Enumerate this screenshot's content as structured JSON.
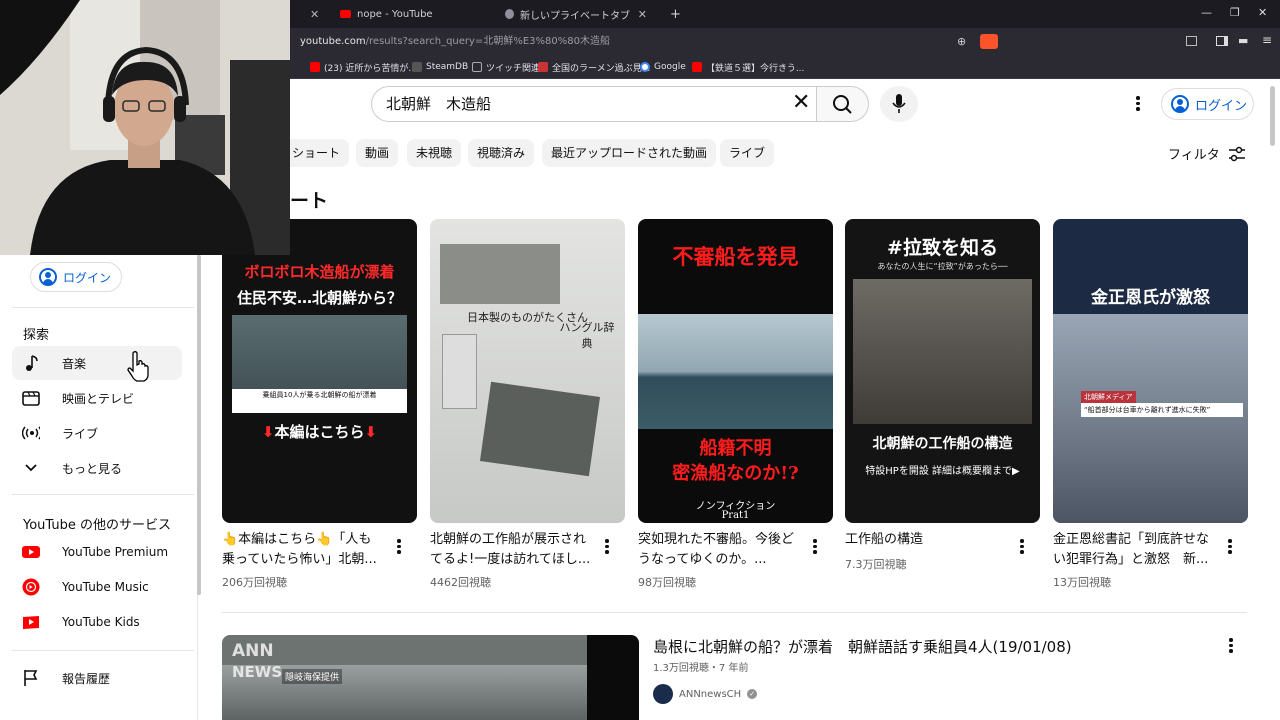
{
  "browser": {
    "tabs": [
      {
        "label": "nope - YouTube",
        "favicon_color": "#ff0000",
        "active": false
      },
      {
        "label": "新しいプライベートタブ",
        "favicon_color": "#8f8fa0",
        "active": false
      }
    ],
    "url_host": "youtube.com",
    "url_path": "/results?search_query=北朝鮮%E3%80%80木造船",
    "bookmarks": [
      {
        "label": "(23) 近所から苦情が...",
        "color": "#ff0000"
      },
      {
        "label": "SteamDB",
        "color": "#555555"
      },
      {
        "label": "ツイッチ関連",
        "color": "#aaaaaa"
      },
      {
        "label": "全国のラーメン過ぶ見...",
        "color": "#cc3333"
      },
      {
        "label": "Google",
        "color": "#4285f4"
      },
      {
        "label": "【鉄道５選】今行きう...",
        "color": "#ff0000"
      }
    ]
  },
  "header": {
    "search_value": "北朝鮮　木造船",
    "login_label": "ログイン"
  },
  "chips": [
    "ショート",
    "動画",
    "未視聴",
    "視聴済み",
    "最近アップロードされた動画",
    "ライブ"
  ],
  "filter_label": "フィルタ",
  "shorts_heading": "ート",
  "shorts": [
    {
      "title": "👆本編はこちら👆「人も乗っていたら怖い」北朝...",
      "views": "206万回視聴",
      "thumb_top": "ボロボロ木造船が漂着",
      "thumb_top2": "住民不安…北朝鮮から？",
      "thumb_bottom": "本編はこちら",
      "thumb_caption": "乗組員10人が乗る北朝鮮の船が漂着"
    },
    {
      "title": "北朝鮮の工作船が展示されてるよ!一度は訪れてほし...",
      "views": "4462回視聴",
      "thumb_top": "日本製のものがたくさん",
      "thumb_top2": "ハングル辞典"
    },
    {
      "title": "突如現れた不審船。今後どうなってゆくのか。...",
      "views": "98万回視聴",
      "thumb_top": "不審船を発見",
      "thumb_mid": "船籍不明",
      "thumb_mid2": "密漁船なのか!?",
      "thumb_bottom": "ノンフィクション",
      "thumb_bottom2": "Prat1"
    },
    {
      "title": "工作船の構造",
      "views": "7.3万回視聴",
      "thumb_top": "#拉致を知る",
      "thumb_top2": "あなたの人生に“拉致”があったら──",
      "thumb_mid": "北朝鮮の工作船の構造",
      "thumb_bottom": "特設HPを開設 詳細は概要欄まで▶"
    },
    {
      "title": "金正恩総書記「到底許せない犯罪行為」と激怒　新...",
      "views": "13万回視聴",
      "thumb_top": "金正恩氏が激怒",
      "thumb_mid": "北朝鮮メディア",
      "thumb_mid2": "“船首部分は台車から離れず進水に失敗”"
    }
  ],
  "sidebar": {
    "login_label": "ログイン",
    "explore_heading": "探索",
    "explore_items": [
      "音楽",
      "映画とテレビ",
      "ライブ",
      "もっと見る"
    ],
    "services_heading": "YouTube の他のサービス",
    "services": [
      "YouTube Premium",
      "YouTube Music",
      "YouTube Kids"
    ],
    "report_history": "報告履歴"
  },
  "result": {
    "title": "島根に北朝鮮の船？が漂着　朝鮮語話す乗組員4人(19/01/08)",
    "meta": "1.3万回視聴・7 年前",
    "channel": "ANNnewsCH",
    "thumb_logo": "ANN",
    "thumb_logo2": "NEWS",
    "thumb_credit": "隠岐海保提供"
  },
  "colors": {
    "brand_red": "#ff0000",
    "link_blue": "#065fd4",
    "chip_bg": "#f2f2f2"
  }
}
